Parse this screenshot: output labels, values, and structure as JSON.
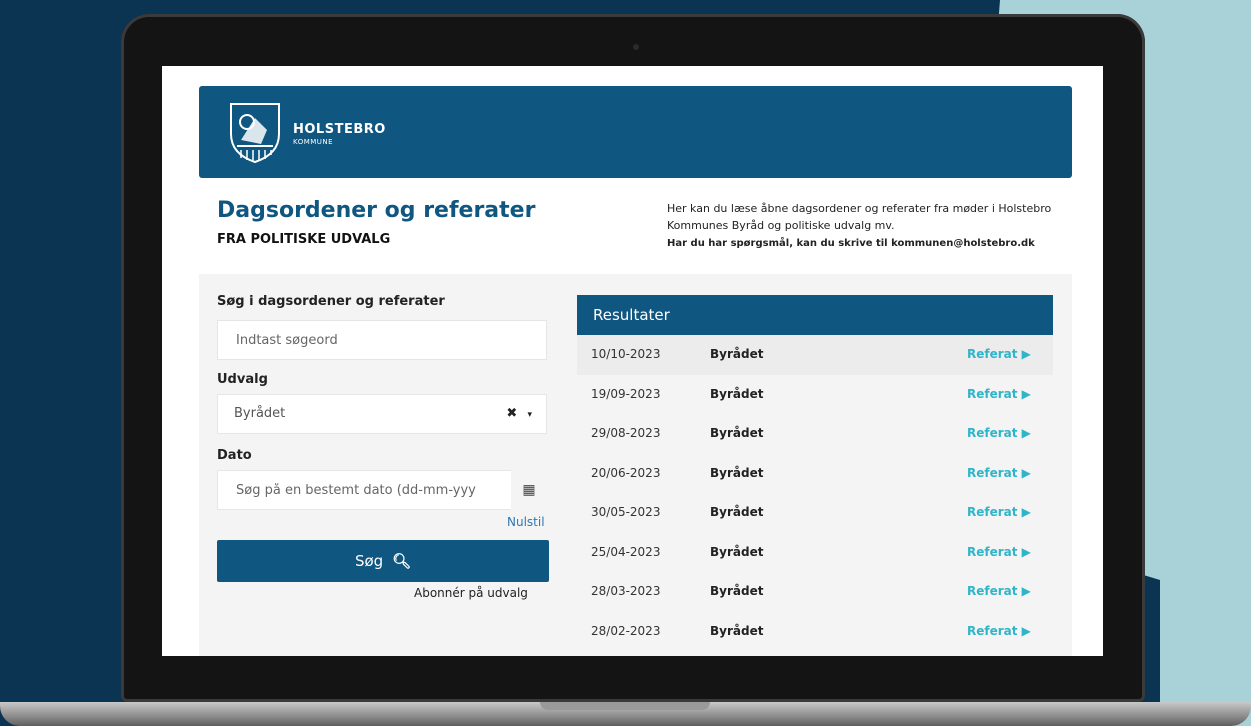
{
  "header": {
    "brand_name": "HOLSTEBRO",
    "brand_sub": "KOMMUNE",
    "crest_icon": "coat-of-arms-icon"
  },
  "page": {
    "title": "Dagsordener og referater",
    "subtitle": "FRA POLITISKE UDVALG",
    "intro": "Her kan du læse åbne dagsordener og referater fra møder i Holstebro Kommunes Byråd og politiske udvalg mv.",
    "contact": "Har du har spørgsmål, kan du skrive til kommunen@holstebro.dk"
  },
  "search": {
    "label": "Søg i dagsordener og referater",
    "placeholder": "Indtast søgeord",
    "committee_label": "Udvalg",
    "committee_value": "Byrådet",
    "date_label": "Dato",
    "date_placeholder": "Søg på en bestemt dato (dd-mm-yyy",
    "reset_label": "Nulstil",
    "search_button": "Søg",
    "subscribe_label": "Abonnér på udvalg"
  },
  "results": {
    "title": "Resultater",
    "rows": [
      {
        "date": "10/10-2023",
        "committee": "Byrådet",
        "link": "Referat ▶"
      },
      {
        "date": "19/09-2023",
        "committee": "Byrådet",
        "link": "Referat ▶"
      },
      {
        "date": "29/08-2023",
        "committee": "Byrådet",
        "link": "Referat ▶"
      },
      {
        "date": "20/06-2023",
        "committee": "Byrådet",
        "link": "Referat ▶"
      },
      {
        "date": "30/05-2023",
        "committee": "Byrådet",
        "link": "Referat ▶"
      },
      {
        "date": "25/04-2023",
        "committee": "Byrådet",
        "link": "Referat ▶"
      },
      {
        "date": "28/03-2023",
        "committee": "Byrådet",
        "link": "Referat ▶"
      },
      {
        "date": "28/02-2023",
        "committee": "Byrådet",
        "link": "Referat ▶"
      }
    ]
  },
  "colors": {
    "primary": "#0f5680",
    "link": "#2fb5c9",
    "background": "#0b3352",
    "accent_shape": "#a9d2d8"
  }
}
